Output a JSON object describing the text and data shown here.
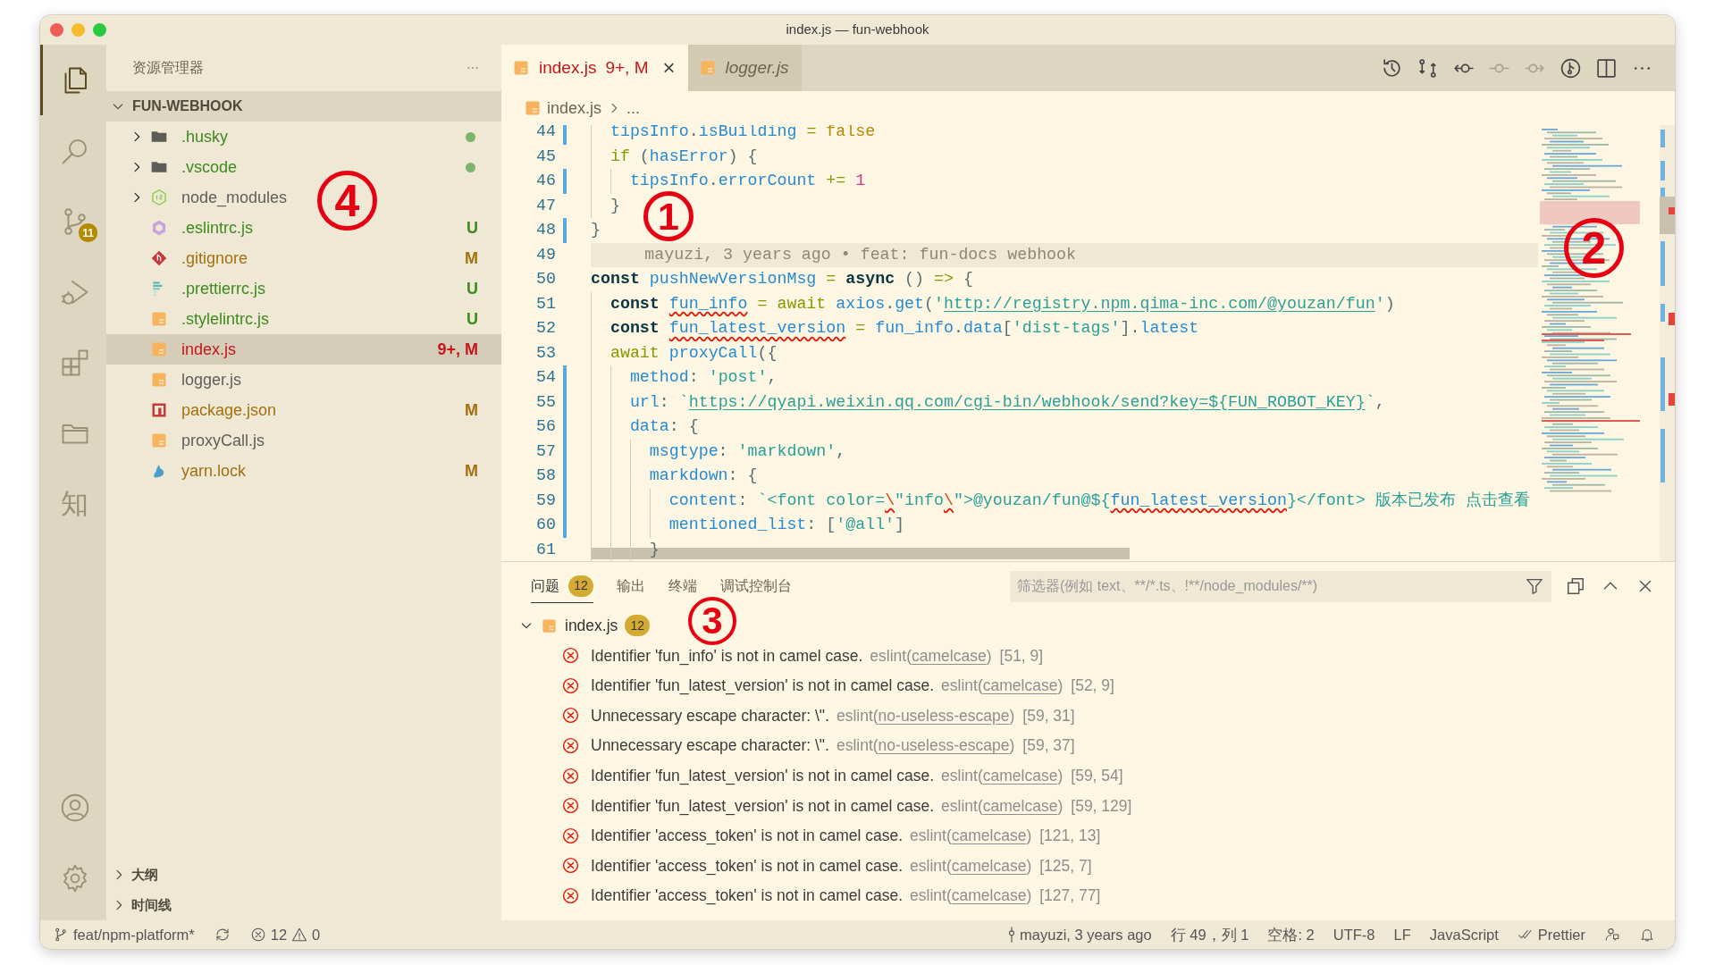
{
  "window": {
    "title": "index.js — fun-webhook"
  },
  "activity_bar": {
    "top": [
      {
        "kind": "files",
        "selected": true
      },
      {
        "kind": "search",
        "selected": false
      },
      {
        "kind": "scm",
        "selected": false,
        "badge": "11"
      },
      {
        "kind": "debug",
        "selected": false
      },
      {
        "kind": "extensions",
        "selected": false
      },
      {
        "kind": "folder",
        "selected": false
      },
      {
        "kind": "glyph",
        "selected": false,
        "text": "知"
      }
    ],
    "bottom": [
      {
        "kind": "account",
        "selected": false
      },
      {
        "kind": "settings",
        "selected": false
      }
    ]
  },
  "sidebar": {
    "title": "资源管理器",
    "folder": {
      "label": "FUN-WEBHOOK",
      "expanded": true
    },
    "items": [
      {
        "label": ".husky",
        "kind": "folder",
        "color": "#3f8a1e",
        "dot": true,
        "expanded": false,
        "selected": false
      },
      {
        "label": ".vscode",
        "kind": "folder",
        "color": "#3f8a1e",
        "dot": true,
        "expanded": false,
        "selected": false
      },
      {
        "label": "node_modules",
        "kind": "modules",
        "color": "#5f5e5a",
        "dot": false,
        "expanded": false,
        "selected": false
      },
      {
        "label": ".eslintrc.js",
        "kind": "eslint",
        "color": "#3f8a1e",
        "decoration": "U",
        "selected": false
      },
      {
        "label": ".gitignore",
        "kind": "gitignore",
        "color": "#a4700f",
        "decoration": "M",
        "selected": false
      },
      {
        "label": ".prettierrc.js",
        "kind": "prettier",
        "color": "#3f8a1e",
        "decoration": "U",
        "selected": false
      },
      {
        "label": ".stylelintrc.js",
        "kind": "script",
        "color": "#3f8a1e",
        "decoration": "U",
        "selected": false
      },
      {
        "label": "index.js",
        "kind": "script",
        "color": "#c4161c",
        "decoration": "9+, M",
        "selected": true
      },
      {
        "label": "logger.js",
        "kind": "script",
        "color": "#5f5e5a",
        "selected": false
      },
      {
        "label": "package.json",
        "kind": "manifest",
        "color": "#a4700f",
        "decoration": "M",
        "selected": false
      },
      {
        "label": "proxyCall.js",
        "kind": "script",
        "color": "#5f5e5a",
        "selected": false
      },
      {
        "label": "yarn.lock",
        "kind": "lockfile",
        "color": "#a4700f",
        "decoration": "M",
        "selected": false
      }
    ],
    "sections": [
      {
        "label": "大纲",
        "expanded": false
      },
      {
        "label": "时间线",
        "expanded": false
      }
    ]
  },
  "editor": {
    "tabs": [
      {
        "label": "index.js",
        "decoration": "9+, M",
        "color": "#c4161c",
        "selected": true,
        "preview": false,
        "close": "×"
      },
      {
        "label": "logger.js",
        "color": "#6b6450",
        "selected": false,
        "preview": true
      }
    ],
    "actions": [
      {
        "kind": "history",
        "disabled": false
      },
      {
        "kind": "compare",
        "disabled": false
      },
      {
        "kind": "prev-change",
        "disabled": false
      },
      {
        "kind": "commit-line",
        "disabled": true
      },
      {
        "kind": "next-change",
        "disabled": true
      },
      {
        "kind": "graph",
        "disabled": false
      },
      {
        "kind": "split",
        "disabled": false
      },
      {
        "kind": "more",
        "disabled": false
      }
    ],
    "breadcrumb": [
      "index.js",
      "..."
    ],
    "lines": [
      {
        "number": "44",
        "changed": true,
        "selected": false,
        "tokens": [
          {
            "kind": "var",
            "text": "  tipsInfo"
          },
          {
            "kind": "punc",
            "text": "."
          },
          {
            "kind": "var",
            "text": "isBuilding"
          },
          {
            "kind": "op",
            "text": " = "
          },
          {
            "kind": "bool",
            "text": "false"
          }
        ]
      },
      {
        "number": "45",
        "changed": false,
        "selected": false,
        "tokens": [
          {
            "kind": "ctrl",
            "text": "  if"
          },
          {
            "kind": "punc",
            "text": " ("
          },
          {
            "kind": "var",
            "text": "hasError"
          },
          {
            "kind": "punc",
            "text": ") {"
          }
        ]
      },
      {
        "number": "46",
        "changed": true,
        "selected": false,
        "tokens": [
          {
            "kind": "var",
            "text": "    tipsInfo"
          },
          {
            "kind": "punc",
            "text": "."
          },
          {
            "kind": "var",
            "text": "errorCount"
          },
          {
            "kind": "op",
            "text": " += "
          },
          {
            "kind": "num",
            "text": "1"
          }
        ]
      },
      {
        "number": "47",
        "changed": false,
        "selected": false,
        "tokens": [
          {
            "kind": "punc",
            "text": "  }"
          }
        ]
      },
      {
        "number": "48",
        "changed": true,
        "selected": false,
        "tokens": [
          {
            "kind": "punc",
            "text": "}"
          }
        ]
      },
      {
        "number": "49",
        "changed": false,
        "selected": true,
        "blame": "mayuzi, 3 years ago • feat: fun-docs webhook"
      },
      {
        "number": "50",
        "changed": false,
        "selected": false,
        "tokens": [
          {
            "kind": "kw",
            "text": "const "
          },
          {
            "kind": "var",
            "text": "pushNewVersionMsg"
          },
          {
            "kind": "op",
            "text": " = "
          },
          {
            "kind": "kw",
            "text": "async"
          },
          {
            "kind": "punc",
            "text": " () "
          },
          {
            "kind": "op",
            "text": "=>"
          },
          {
            "kind": "punc",
            "text": " {"
          }
        ]
      },
      {
        "number": "51",
        "changed": false,
        "selected": false,
        "tokens": [
          {
            "kind": "kw",
            "text": "  const "
          },
          {
            "kind": "var-error",
            "text": "fun_info"
          },
          {
            "kind": "op",
            "text": " = "
          },
          {
            "kind": "ctrl",
            "text": "await "
          },
          {
            "kind": "var",
            "text": "axios"
          },
          {
            "kind": "punc",
            "text": "."
          },
          {
            "kind": "var",
            "text": "get"
          },
          {
            "kind": "punc",
            "text": "("
          },
          {
            "kind": "str",
            "text": "'"
          },
          {
            "kind": "link",
            "text": "http://registry.npm.qima-inc.com/@youzan/fun"
          },
          {
            "kind": "str",
            "text": "'"
          },
          {
            "kind": "punc",
            "text": ")"
          }
        ]
      },
      {
        "number": "52",
        "changed": false,
        "selected": false,
        "tokens": [
          {
            "kind": "kw",
            "text": "  const "
          },
          {
            "kind": "var-error",
            "text": "fun_latest_version"
          },
          {
            "kind": "op",
            "text": " = "
          },
          {
            "kind": "var",
            "text": "fun_info"
          },
          {
            "kind": "punc",
            "text": "."
          },
          {
            "kind": "var",
            "text": "data"
          },
          {
            "kind": "punc",
            "text": "["
          },
          {
            "kind": "str",
            "text": "'dist-tags'"
          },
          {
            "kind": "punc",
            "text": "]."
          },
          {
            "kind": "var",
            "text": "latest"
          }
        ]
      },
      {
        "number": "53",
        "changed": false,
        "selected": false,
        "tokens": [
          {
            "kind": "ctrl",
            "text": "  await "
          },
          {
            "kind": "var",
            "text": "proxyCall"
          },
          {
            "kind": "punc",
            "text": "({"
          }
        ]
      },
      {
        "number": "54",
        "changed": true,
        "selected": false,
        "tokens": [
          {
            "kind": "var",
            "text": "    method"
          },
          {
            "kind": "punc",
            "text": ": "
          },
          {
            "kind": "str",
            "text": "'post'"
          },
          {
            "kind": "punc",
            "text": ","
          }
        ]
      },
      {
        "number": "55",
        "changed": true,
        "selected": false,
        "tokens": [
          {
            "kind": "var",
            "text": "    url"
          },
          {
            "kind": "punc",
            "text": ": "
          },
          {
            "kind": "str",
            "text": "`"
          },
          {
            "kind": "link",
            "text": "https://qyapi.weixin.qq.com/cgi-bin/webhook/send?key=${FUN_ROBOT_KEY}"
          },
          {
            "kind": "str",
            "text": "`"
          },
          {
            "kind": "punc",
            "text": ","
          }
        ]
      },
      {
        "number": "56",
        "changed": true,
        "selected": false,
        "tokens": [
          {
            "kind": "var",
            "text": "    data"
          },
          {
            "kind": "punc",
            "text": ": {"
          }
        ]
      },
      {
        "number": "57",
        "changed": true,
        "selected": false,
        "tokens": [
          {
            "kind": "var",
            "text": "      msgtype"
          },
          {
            "kind": "punc",
            "text": ": "
          },
          {
            "kind": "str",
            "text": "'markdown'"
          },
          {
            "kind": "punc",
            "text": ","
          }
        ]
      },
      {
        "number": "58",
        "changed": true,
        "selected": false,
        "tokens": [
          {
            "kind": "var",
            "text": "      markdown"
          },
          {
            "kind": "punc",
            "text": ": {"
          }
        ]
      },
      {
        "number": "59",
        "changed": true,
        "selected": false,
        "tokens": [
          {
            "kind": "var",
            "text": "        content"
          },
          {
            "kind": "punc",
            "text": ": "
          },
          {
            "kind": "str",
            "text": "`<font color="
          },
          {
            "kind": "esc-error",
            "text": "\\"
          },
          {
            "kind": "str",
            "text": "\"info"
          },
          {
            "kind": "esc-error",
            "text": "\\"
          },
          {
            "kind": "str",
            "text": "\">@youzan/fun@${"
          },
          {
            "kind": "var-error",
            "text": "fun_latest_version"
          },
          {
            "kind": "str",
            "text": "}</font> 版本已发布 点击查看"
          }
        ]
      },
      {
        "number": "60",
        "changed": true,
        "selected": false,
        "tokens": [
          {
            "kind": "var",
            "text": "        mentioned_list"
          },
          {
            "kind": "punc",
            "text": ": ["
          },
          {
            "kind": "str",
            "text": "'@all'"
          },
          {
            "kind": "punc",
            "text": "]"
          }
        ]
      },
      {
        "number": "61",
        "changed": false,
        "selected": false,
        "tokens": [
          {
            "kind": "punc",
            "text": "      }"
          }
        ]
      }
    ]
  },
  "panel": {
    "tabs": [
      {
        "label": "问题",
        "badge": "12",
        "selected": true
      },
      {
        "label": "输出",
        "selected": false
      },
      {
        "label": "终端",
        "selected": false
      },
      {
        "label": "调试控制台",
        "selected": false
      }
    ],
    "filter": {
      "placeholder": "筛选器(例如 text、**/*.ts、!**/node_modules/**)"
    },
    "tree": {
      "label": "index.js",
      "badge": "12",
      "expanded": true,
      "problems": [
        {
          "message": "Identifier 'fun_info' is not in camel case.",
          "source": "eslint(",
          "rule": "camelcase",
          "source_end": ")",
          "position": "[51, 9]"
        },
        {
          "message": "Identifier 'fun_latest_version' is not in camel case.",
          "source": "eslint(",
          "rule": "camelcase",
          "source_end": ")",
          "position": "[52, 9]"
        },
        {
          "message": "Unnecessary escape character: \\\".",
          "source": "eslint(",
          "rule": "no-useless-escape",
          "source_end": ")",
          "position": "[59, 31]"
        },
        {
          "message": "Unnecessary escape character: \\\".",
          "source": "eslint(",
          "rule": "no-useless-escape",
          "source_end": ")",
          "position": "[59, 37]"
        },
        {
          "message": "Identifier 'fun_latest_version' is not in camel case.",
          "source": "eslint(",
          "rule": "camelcase",
          "source_end": ")",
          "position": "[59, 54]"
        },
        {
          "message": "Identifier 'fun_latest_version' is not in camel case.",
          "source": "eslint(",
          "rule": "camelcase",
          "source_end": ")",
          "position": "[59, 129]"
        },
        {
          "message": "Identifier 'access_token' is not in camel case.",
          "source": "eslint(",
          "rule": "camelcase",
          "source_end": ")",
          "position": "[121, 13]"
        },
        {
          "message": "Identifier 'access_token' is not in camel case.",
          "source": "eslint(",
          "rule": "camelcase",
          "source_end": ")",
          "position": "[125, 7]"
        },
        {
          "message": "Identifier 'access_token' is not in camel case.",
          "source": "eslint(",
          "rule": "camelcase",
          "source_end": ")",
          "position": "[127, 77]"
        }
      ]
    }
  },
  "status_bar": {
    "branch": "feat/npm-platform*",
    "errors": "12",
    "warnings": "0",
    "blame": "mayuzi, 3 years ago",
    "cursor": "行 49，列 1",
    "indent": "空格: 2",
    "encoding": "UTF-8",
    "eol": "LF",
    "language": "JavaScript",
    "formatter": "Prettier"
  },
  "annotations": [
    {
      "number": "1"
    },
    {
      "number": "2"
    },
    {
      "number": "3"
    },
    {
      "number": "4"
    }
  ]
}
